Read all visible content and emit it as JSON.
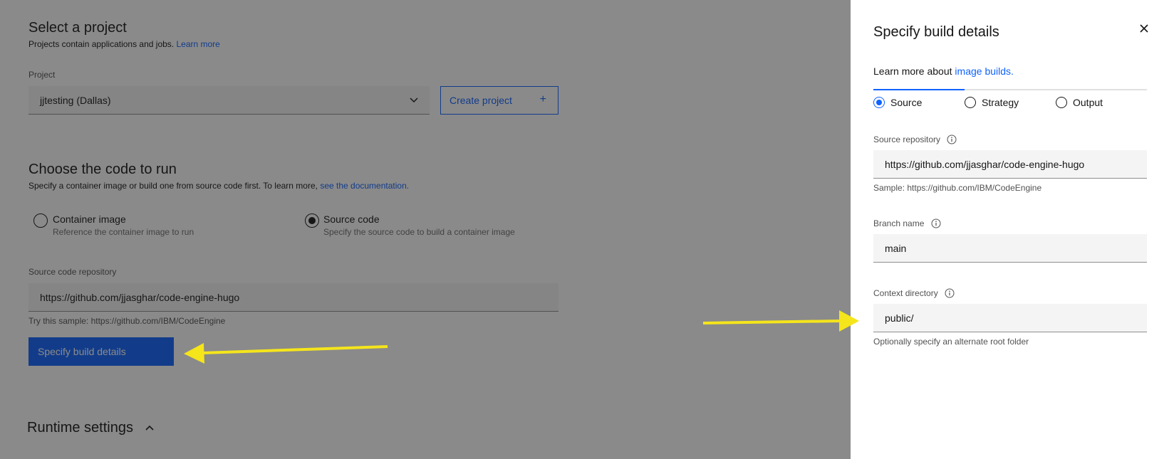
{
  "project_section": {
    "title": "Select a project",
    "description": "Projects contain applications and jobs.",
    "learn_more": "Learn more",
    "project_label": "Project",
    "project_value": "jjtesting (Dallas)",
    "create_project": "Create project"
  },
  "code_section": {
    "title": "Choose the code to run",
    "description": "Specify a container image or build one from source code first. To learn more,",
    "doc_link": "see the documentation.",
    "options": [
      {
        "title": "Container image",
        "desc": "Reference the container image to run",
        "checked": false
      },
      {
        "title": "Source code",
        "desc": "Specify the source code to build a container image",
        "checked": true
      }
    ],
    "repo_label": "Source code repository",
    "repo_value": "https://github.com/jjasghar/code-engine-hugo",
    "repo_helper": "Try this sample: https://github.com/IBM/CodeEngine",
    "build_button": "Specify build details"
  },
  "runtime": {
    "title": "Runtime settings"
  },
  "panel": {
    "title": "Specify build details",
    "intro": "Learn more about",
    "intro_link": "image builds.",
    "tabs": [
      {
        "label": "Source",
        "checked": true
      },
      {
        "label": "Strategy",
        "checked": false
      },
      {
        "label": "Output",
        "checked": false
      }
    ],
    "source_repo_label": "Source repository",
    "source_repo_value": "https://github.com/jjasghar/code-engine-hugo",
    "source_repo_helper": "Sample: https://github.com/IBM/CodeEngine",
    "branch_label": "Branch name",
    "branch_value": "main",
    "context_label": "Context directory",
    "context_value": "public/",
    "context_helper": "Optionally specify an alternate root folder"
  },
  "colors": {
    "accent": "#0f62fe",
    "annotation_arrow": "#f5e51b"
  }
}
